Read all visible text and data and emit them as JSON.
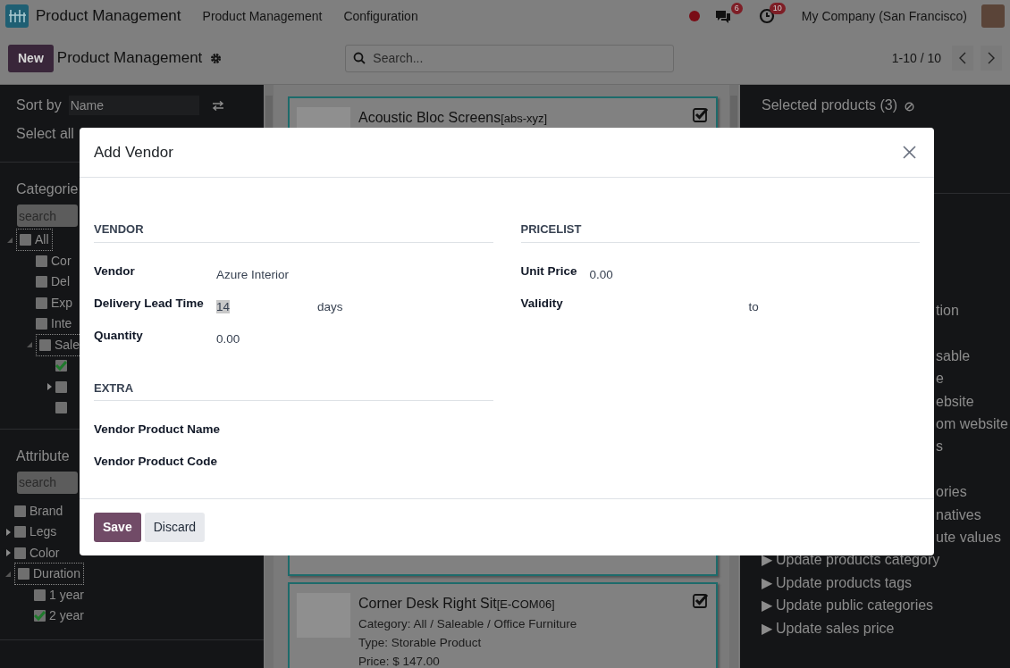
{
  "navbar": {
    "app_name": "Product Management",
    "menu": [
      "Product Management",
      "Configuration"
    ],
    "chat_badge": "6",
    "activity_badge": "10",
    "company": "My Company (San Francisco)"
  },
  "control_panel": {
    "new_button": "New",
    "title": "Product Management",
    "search_placeholder": "Search...",
    "pager": "1-10 / 10"
  },
  "sidebar": {
    "sort_label": "Sort by",
    "sort_value": "Name",
    "select_all": "Select all",
    "categories_title": "Categorie",
    "categories_search_placeholder": "search",
    "categories": [
      {
        "label": "All",
        "checked": false,
        "focused": true,
        "expanded": true,
        "children": [
          {
            "label": "Cor",
            "checked": false
          },
          {
            "label": "Del",
            "checked": false
          },
          {
            "label": "Exp",
            "checked": false
          },
          {
            "label": "Inte",
            "checked": false
          },
          {
            "label": "Sale",
            "checked": false,
            "focused": true,
            "expanded": true,
            "children": [
              {
                "checked": true
              },
              {
                "checked": false,
                "expanded": false
              },
              {
                "checked": false
              }
            ]
          }
        ]
      }
    ],
    "attributes_title": "Attribute",
    "attributes_search_placeholder": "search",
    "attributes": [
      {
        "label": "Brand",
        "checked": false
      },
      {
        "label": "Legs",
        "checked": false,
        "expanded": false
      },
      {
        "label": "Color",
        "checked": false,
        "expanded": false
      },
      {
        "label": "Duration",
        "checked": false,
        "focused": true,
        "expanded": true,
        "children": [
          {
            "label": "1 year",
            "checked": false
          },
          {
            "label": "2 year",
            "checked": true
          }
        ]
      }
    ]
  },
  "products": [
    {
      "title": "Acoustic Bloc Screens",
      "code": "[abs-xyz]",
      "selected": true
    },
    {
      "title": "Corner Desk Right Sit",
      "code": "[E-COM06]",
      "selected": true,
      "lines": [
        "Category: All / Saleable / Office Furniture",
        "Type: Storable Product",
        "Price: $ 147.00"
      ]
    }
  ],
  "selection_panel": {
    "title": "Selected products (3)",
    "action_groups": [
      [
        {
          "label": "tion"
        }
      ],
      [
        {
          "label": "sable"
        },
        {
          "label": "e"
        },
        {
          "label": "ebsite"
        },
        {
          "label": "om website"
        },
        {
          "label": "s"
        }
      ],
      [
        {
          "label": "ories"
        },
        {
          "label": "natives"
        },
        {
          "label": "ute values"
        },
        {
          "arrow": "▶",
          "label": "Update products category"
        },
        {
          "arrow": "▶",
          "label": "Update products tags"
        },
        {
          "arrow": "▶",
          "label": "Update public categories"
        },
        {
          "arrow": "▶",
          "label": "Update sales price"
        }
      ]
    ]
  },
  "modal": {
    "title": "Add Vendor",
    "left": [
      {
        "heading": "VENDOR",
        "rows": [
          {
            "kind": "text",
            "label": "Vendor",
            "value": "Azure Interior"
          },
          {
            "kind": "number_unit",
            "label": "Delivery Lead Time",
            "value": "14",
            "value_selected": true,
            "unit": "days"
          },
          {
            "kind": "text",
            "label": "Quantity",
            "value": "0.00"
          }
        ]
      },
      {
        "heading": "EXTRA",
        "rows": [
          {
            "kind": "text",
            "label": "Vendor Product Name"
          },
          {
            "kind": "text",
            "label": "Vendor Product Code"
          }
        ]
      }
    ],
    "right": [
      {
        "heading": "PRICELIST",
        "rows": [
          {
            "kind": "text",
            "label": "Unit Price",
            "value": "0.00"
          },
          {
            "kind": "date_range",
            "label": "Validity",
            "separator": "to"
          }
        ]
      }
    ],
    "buttons": [
      {
        "label": "Save",
        "kind": "primary"
      },
      {
        "label": "Discard",
        "kind": "secondary"
      }
    ]
  }
}
